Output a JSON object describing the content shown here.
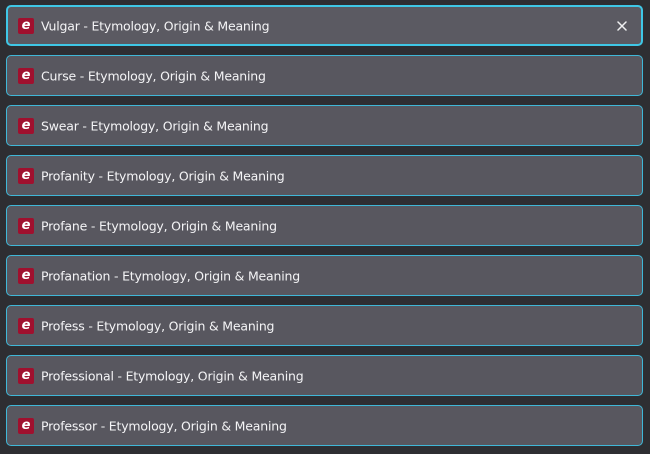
{
  "tabs": [
    {
      "title": "Vulgar - Etymology, Origin & Meaning",
      "favicon": "e",
      "active": true,
      "close_icon": "close-icon"
    },
    {
      "title": "Curse - Etymology, Origin & Meaning",
      "favicon": "e"
    },
    {
      "title": "Swear - Etymology, Origin & Meaning",
      "favicon": "e"
    },
    {
      "title": "Profanity - Etymology, Origin & Meaning",
      "favicon": "e"
    },
    {
      "title": "Profane - Etymology, Origin & Meaning",
      "favicon": "e"
    },
    {
      "title": "Profanation - Etymology, Origin & Meaning",
      "favicon": "e"
    },
    {
      "title": "Profess - Etymology, Origin & Meaning",
      "favicon": "e"
    },
    {
      "title": "Professional - Etymology, Origin & Meaning",
      "favicon": "e"
    },
    {
      "title": "Professor - Etymology, Origin & Meaning",
      "favicon": "e"
    }
  ],
  "colors": {
    "background": "#2e2e32",
    "tab_background": "#58575f",
    "tab_border": "#40b8d8",
    "favicon": "#a0102e",
    "text": "#f4f4f6"
  }
}
